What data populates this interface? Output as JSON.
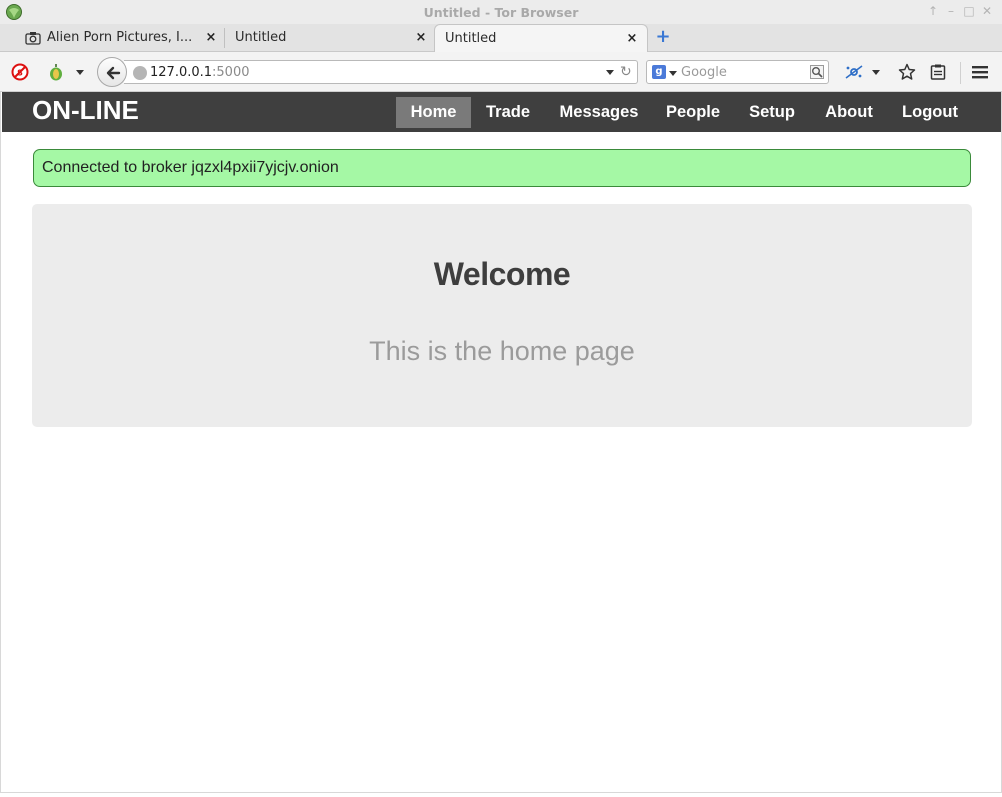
{
  "window": {
    "title": "Untitled - Tor Browser"
  },
  "tabs": [
    {
      "label": "Alien Porn Pictures, I...",
      "icon": "camera-icon",
      "active": false
    },
    {
      "label": "Untitled",
      "active": false
    },
    {
      "label": "Untitled",
      "active": true
    }
  ],
  "toolbar": {
    "url_host": "127.0.0.1",
    "url_port": ":5000",
    "search_placeholder": "Google",
    "search_engine_letter": "g"
  },
  "site": {
    "brand": "ON-LINE",
    "menu": [
      {
        "label": "Home",
        "active": true
      },
      {
        "label": "Trade",
        "active": false
      },
      {
        "label": "Messages",
        "active": false
      },
      {
        "label": "People",
        "active": false
      },
      {
        "label": "Setup",
        "active": false
      },
      {
        "label": "About",
        "active": false
      },
      {
        "label": "Logout",
        "active": false
      }
    ],
    "alert": "Connected to broker jqzxl4pxii7yjcjv.onion",
    "welcome_title": "Welcome",
    "welcome_subtitle": "This is the home page"
  },
  "colors": {
    "nav_bg": "#3f3f3f",
    "nav_active": "#7a7a7a",
    "alert_bg": "#a5f8a5",
    "alert_border": "#3a8a3a",
    "jumbotron_bg": "#ececec"
  }
}
